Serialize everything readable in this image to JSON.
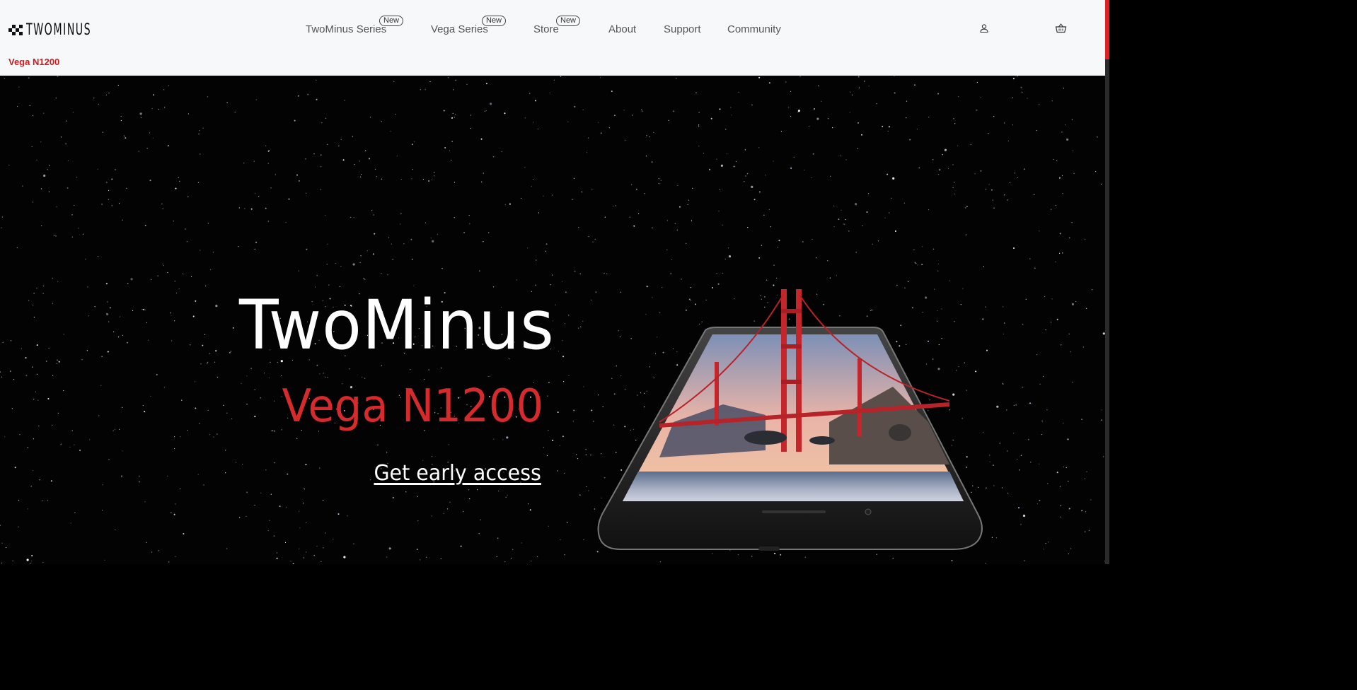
{
  "header": {
    "logo_text": "TWOMINUS",
    "subtitle": "Vega N1200",
    "nav": [
      {
        "label": "TwoMinus Series",
        "badge": "New"
      },
      {
        "label": "Vega Series",
        "badge": "New"
      },
      {
        "label": "Store",
        "badge": "New"
      },
      {
        "label": "About"
      },
      {
        "label": "Support"
      },
      {
        "label": "Community"
      }
    ],
    "icons": {
      "account": "user-icon",
      "cart": "cart-icon"
    }
  },
  "hero": {
    "brand": "TwoMinus",
    "model": "Vega N1200",
    "cta": "Get early access"
  },
  "colors": {
    "accent": "#d0191c",
    "header_bg": "#f7f8fa",
    "hero_bg": "#030303"
  }
}
